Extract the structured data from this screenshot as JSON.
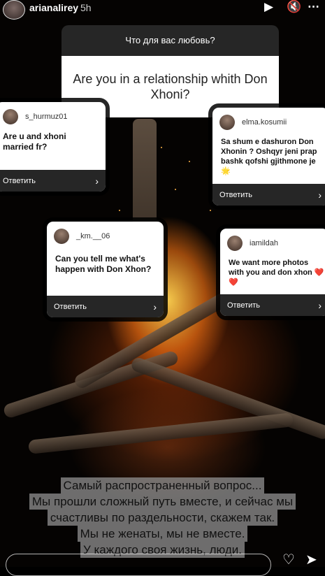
{
  "story": {
    "username": "arianalirey",
    "time_ago": "5h",
    "icons": [
      "play-icon",
      "mute-icon",
      "more-icon"
    ]
  },
  "question": {
    "header": "Что для вас любовь?",
    "text": "Are you in a relationship whith Don Xhoni?"
  },
  "answers": [
    {
      "user": "s_hurmuz01",
      "text": "Are u and xhoni married fr?",
      "reply": "Ответить"
    },
    {
      "user": "elma.kosumii",
      "text": "Sa shum e dashuron Don Xhonin ? Oshqyr jeni prap bashk qofshi gjithmone je 🌟",
      "reply": "Ответить"
    },
    {
      "user": "_km.__06",
      "text": "Can you tell me what's happen with Don Xhon?",
      "reply": "Ответить"
    },
    {
      "user": "iamildah",
      "text": "We want more photos with you and don xhon ❤️❤️",
      "reply": "Ответить"
    }
  ],
  "caption": [
    "Самый распространенный вопрос...",
    "Мы прошли сложный путь вместе, и сейчас мы",
    "счастливы по раздельности, скажем так.",
    "Мы не женаты, мы не вместе.",
    "У каждого своя жизнь, люди."
  ],
  "colors": {
    "card_footer": "#262626",
    "caption_bg": "#919191"
  }
}
